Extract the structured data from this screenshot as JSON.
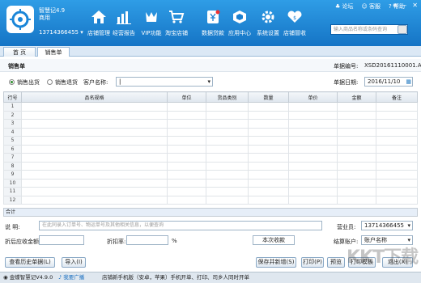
{
  "app": {
    "version_label": "智慧记4.9",
    "edition": "商用",
    "phone": "13714366455"
  },
  "toplinks": {
    "forum": "论坛",
    "service": "客服",
    "help": "帮助"
  },
  "nav": [
    {
      "label": "店铺管理",
      "icon": "home-icon"
    },
    {
      "label": "经营报告",
      "icon": "bar-chart-icon"
    },
    {
      "label": "VIP功能",
      "icon": "vip-icon"
    },
    {
      "label": "淘宝店铺",
      "icon": "cart-icon"
    },
    {
      "label": "数据贷款",
      "icon": "loan-icon"
    },
    {
      "label": "应用中心",
      "icon": "apps-icon"
    },
    {
      "label": "系统设置",
      "icon": "gear-icon"
    },
    {
      "label": "店铺冒收",
      "icon": "heart-icon"
    }
  ],
  "search": {
    "placeholder": "输入商品名称或条码查询"
  },
  "tabs": [
    {
      "label": "首 页"
    },
    {
      "label": "销售单"
    }
  ],
  "form": {
    "title": "销售单",
    "doc_no_label": "单据编号:",
    "doc_no": "XSD20161110001.A",
    "radio_sale": "销售出货",
    "radio_return": "销售退货",
    "customer_label": "客户名称:",
    "date_label": "单据日期:",
    "date": "2016/11/10"
  },
  "table": {
    "headers": [
      "行号",
      "品名规格",
      "单位",
      "货品类别",
      "数量",
      "单价",
      "金额",
      "备注"
    ],
    "rows": [
      "1",
      "2",
      "3",
      "4",
      "5",
      "6",
      "7",
      "8",
      "9",
      "10",
      "11",
      "12"
    ],
    "total_label": "合计"
  },
  "footer": {
    "note_label": "说    明:",
    "note_placeholder": "在此同录入订单号、物运单号及其他相关信息，以便查询",
    "salesperson_label": "营业员:",
    "salesperson": "13714366455",
    "discount_amount_label": "折后应收金额:",
    "discount_rate_label": "折扣率:",
    "percent": "%",
    "received_label": "本次收款",
    "settle_label": "结算账户:",
    "settle_value": "账户名称"
  },
  "buttons": {
    "history": "查看历史单据(L)",
    "import": "导入(I)",
    "save_new": "保存并新增(S)",
    "print": "打印(P)",
    "preview": "预览",
    "print_template": "打印模板",
    "close": "退出(X)"
  },
  "statusbar": {
    "version": "金蝶智慧记V4.9.0",
    "news_label": "我要广播",
    "message": "店铺新手机版（安卓，苹果）手机开单、打印、司乡人同时开单"
  },
  "watermark": "KKT下载"
}
